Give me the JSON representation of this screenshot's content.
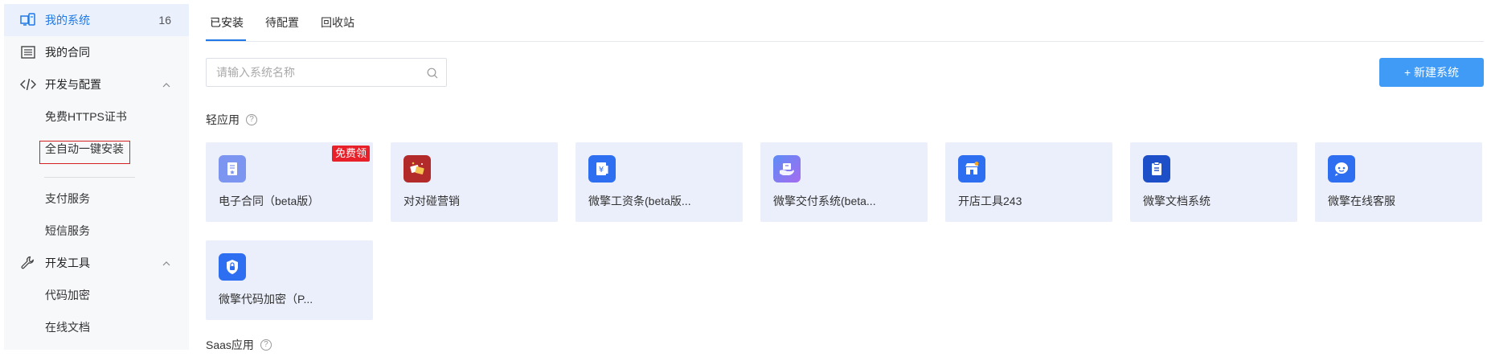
{
  "sidebar": {
    "items": [
      {
        "label": "我的系统",
        "count": "16",
        "icon": "device-icon"
      },
      {
        "label": "我的合同",
        "icon": "contract-list-icon"
      },
      {
        "label": "开发与配置",
        "icon": "code-icon"
      },
      {
        "label": "开发工具",
        "icon": "wrench-icon"
      }
    ],
    "dev_config_children": [
      "免费HTTPS证书",
      "全自动一键安装",
      "支付服务",
      "短信服务"
    ],
    "dev_tools_children": [
      "代码加密",
      "在线文档"
    ]
  },
  "tabs": [
    "已安装",
    "待配置",
    "回收站"
  ],
  "search": {
    "placeholder": "请输入系统名称"
  },
  "new_button": "+ 新建系统",
  "sections": {
    "light_apps": "轻应用",
    "saas_apps": "Saas应用",
    "help_glyph": "?"
  },
  "cards": [
    {
      "name": "电子合同（beta版）",
      "badge": "免费领",
      "icon": "e-contract-icon",
      "color": "#6b8cf3"
    },
    {
      "name": "对对碰营销",
      "icon": "marketing-icon",
      "color": "#b22a2a"
    },
    {
      "name": "微擎工资条(beta版...",
      "icon": "payslip-icon",
      "color": "#2e6ef0"
    },
    {
      "name": "微擎交付系统(beta...",
      "icon": "delivery-icon",
      "color": "#7b6cf5"
    },
    {
      "name": "开店工具243",
      "icon": "shop-icon",
      "color": "#2e6ef0"
    },
    {
      "name": "微擎文档系统",
      "icon": "document-icon",
      "color": "#1d4fc8"
    },
    {
      "name": "微擎在线客服",
      "icon": "chat-icon",
      "color": "#2e6ef0"
    },
    {
      "name": "微擎代码加密（P...",
      "icon": "shield-icon",
      "color": "#2e6ef0"
    }
  ]
}
